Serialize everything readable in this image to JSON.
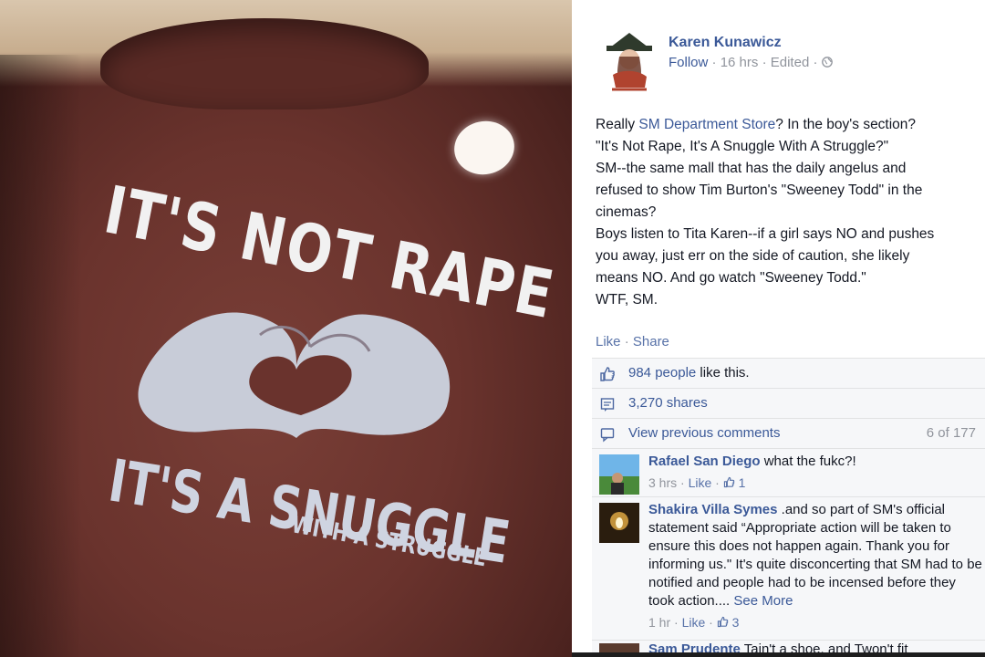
{
  "photo": {
    "shirt_line_1": "IT'S NOT RAPE",
    "shirt_line_2": "IT'S A SNUGGLE",
    "shirt_line_3": "WITH A STRUGGLE",
    "colors": {
      "shirt": "#6a332d",
      "print": "#cfd4e1"
    }
  },
  "post": {
    "author": "Karen Kunawicz",
    "follow": "Follow",
    "time": "16 hrs",
    "edited": "Edited",
    "sep": "·",
    "text": {
      "l1_pre": "Really ",
      "l1_link": "SM Department Store",
      "l1_post": "? In the boy's section?",
      "l2": "\"It's Not Rape, It's A Snuggle With A Struggle?\"",
      "l3": "SM--the same mall that has the daily angelus and",
      "l4": "refused to show Tim Burton's \"Sweeney Todd\" in the",
      "l5": "cinemas?",
      "l6": "Boys listen to Tita Karen--if a girl says NO and pushes",
      "l7": "you away, just err on the side of caution, she likely",
      "l8": "means NO. And go watch \"Sweeney Todd.\"",
      "l9": "WTF, SM."
    },
    "like": "Like",
    "share": "Share",
    "likes_link": "984 people",
    "likes_suffix": " like this.",
    "shares": "3,270 shares",
    "view_previous": "View previous comments",
    "comment_count": "6 of 177",
    "icons": [
      "like-icon",
      "share-icon",
      "comment-icon",
      "globe-icon"
    ],
    "comments": [
      {
        "name": "Rafael San Diego",
        "text": " what the fukc?!",
        "time": "3 hrs",
        "like": "Like",
        "likes": "1"
      },
      {
        "name": "Shakira Villa Symes",
        "text": " .and so part of SM's official statement said “Appropriate action will be taken to ensure this does not happen again. Thank you for informing us.\" It's quite disconcerting that SM had to be notified and people had to be incensed before they took action.... ",
        "see_more": "See More",
        "time": "1 hr",
        "like": "Like",
        "likes": "3"
      }
    ],
    "cut_name": "Sam Prudente",
    "cut_text": " Tain't a shoe, and Twon't fit"
  }
}
